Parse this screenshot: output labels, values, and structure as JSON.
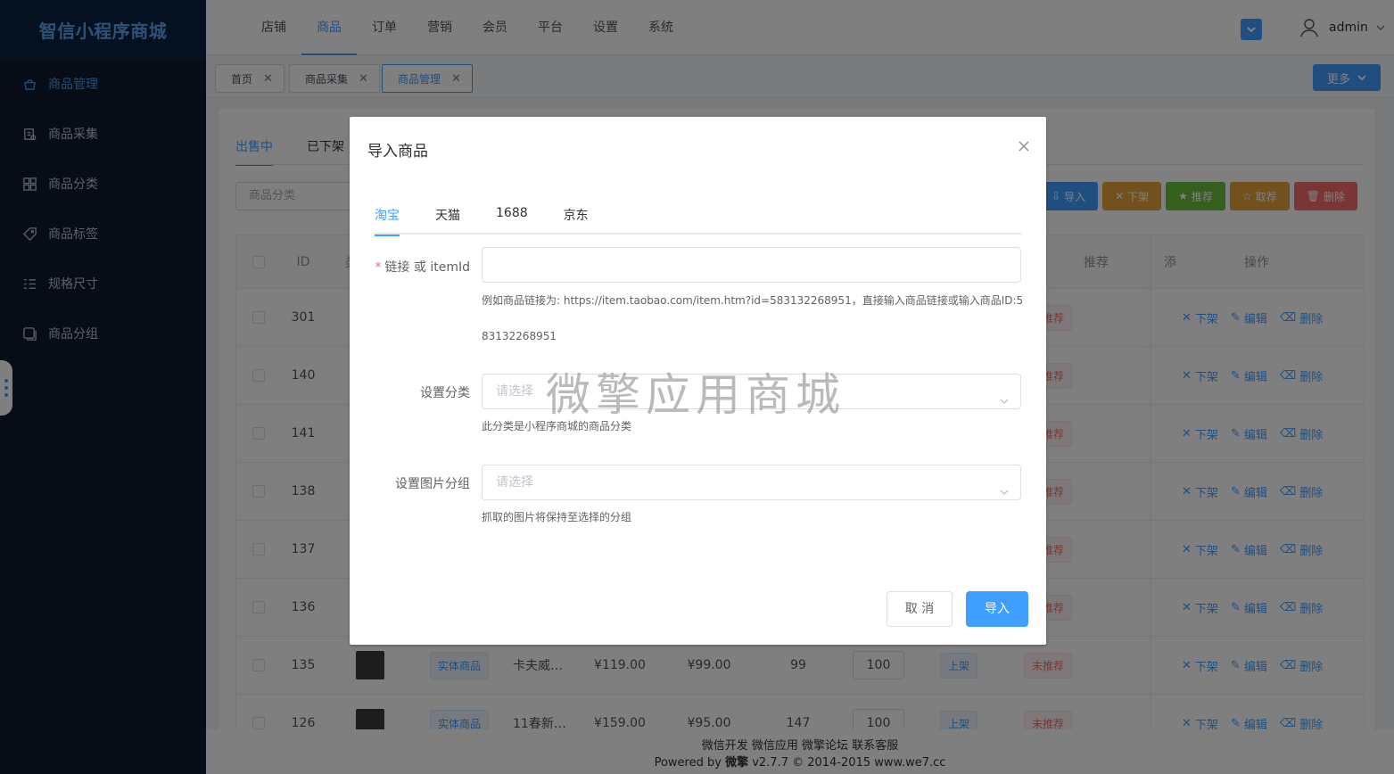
{
  "brand": "智信小程序商城",
  "sidebar": {
    "items": [
      {
        "label": "商品管理",
        "icon": "basket-icon",
        "active": true
      },
      {
        "label": "商品采集",
        "icon": "collect-icon"
      },
      {
        "label": "商品分类",
        "icon": "grid-icon"
      },
      {
        "label": "商品标签",
        "icon": "tag-icon"
      },
      {
        "label": "规格尺寸",
        "icon": "list-icon"
      },
      {
        "label": "商品分组",
        "icon": "group-icon"
      }
    ]
  },
  "topnav": {
    "items": [
      "店铺",
      "商品",
      "订单",
      "营销",
      "会员",
      "平台",
      "设置",
      "系统"
    ],
    "active": "商品"
  },
  "user": {
    "name": "admin"
  },
  "page_tabs": {
    "items": [
      {
        "label": "首页"
      },
      {
        "label": "商品采集"
      },
      {
        "label": "商品管理",
        "active": true
      }
    ],
    "more_label": "更多"
  },
  "content": {
    "subtabs": [
      "出售中",
      "已下架"
    ],
    "filter_placeholder": "商品分类",
    "actions": {
      "import": "导入",
      "off": "下架",
      "recommend": "推荐",
      "unrecommend": "取荐",
      "delete": "删除"
    },
    "columns": {
      "id": "ID",
      "col3": "类",
      "recommend": "推荐",
      "add": "添",
      "ops": "操作"
    },
    "rows": [
      {
        "id": "301",
        "rec": "未推荐"
      },
      {
        "id": "140",
        "rec": "未推荐"
      },
      {
        "id": "141",
        "rec": "未推荐"
      },
      {
        "id": "138",
        "rec": "未推荐"
      },
      {
        "id": "137",
        "rec": "未推荐"
      },
      {
        "id": "136",
        "rec": "未推荐"
      },
      {
        "id": "135",
        "type": "实体商品",
        "name": "卡夫威…",
        "price": "¥119.00",
        "cost": "¥99.00",
        "stock": "99",
        "sort": "100",
        "status": "上架",
        "rec": "未推荐"
      },
      {
        "id": "126",
        "type": "实体商品",
        "name": "11春新…",
        "price": "¥159.00",
        "cost": "¥95.00",
        "stock": "147",
        "sort": "100",
        "status": "上架",
        "rec": "未推荐"
      }
    ],
    "row_ops": {
      "off": "下架",
      "edit": "编辑",
      "delete": "删除"
    }
  },
  "footer": {
    "links": "微信开发 微信应用 微擎论坛 联系客服",
    "powered_prefix": "Powered by ",
    "powered_brand": "微擎",
    "powered_suffix": " v2.7.7 © 2014-2015 www.we7.cc"
  },
  "modal": {
    "title": "导入商品",
    "tabs": [
      "淘宝",
      "天猫",
      "1688",
      "京东"
    ],
    "active_tab": "淘宝",
    "link_label": "链接 或 itemId",
    "link_value": "",
    "link_hint": "例如商品链接为: https://item.taobao.com/item.htm?id=583132268951，直接输入商品链接或输入商品ID:583132268951",
    "category_label": "设置分类",
    "category_placeholder": "请选择",
    "category_hint": "此分类是小程序商城的商品分类",
    "image_group_label": "设置图片分组",
    "image_group_placeholder": "请选择",
    "image_group_hint": "抓取的图片将保持至选择的分组",
    "watermark": "微擎应用商城",
    "cancel": "取 消",
    "confirm": "导入"
  },
  "colors": {
    "primary": "#409eff",
    "sidebar_bg": "#0c1b2e",
    "danger": "#f56c6c",
    "warning": "#e6a23c",
    "success": "#67c23a"
  }
}
